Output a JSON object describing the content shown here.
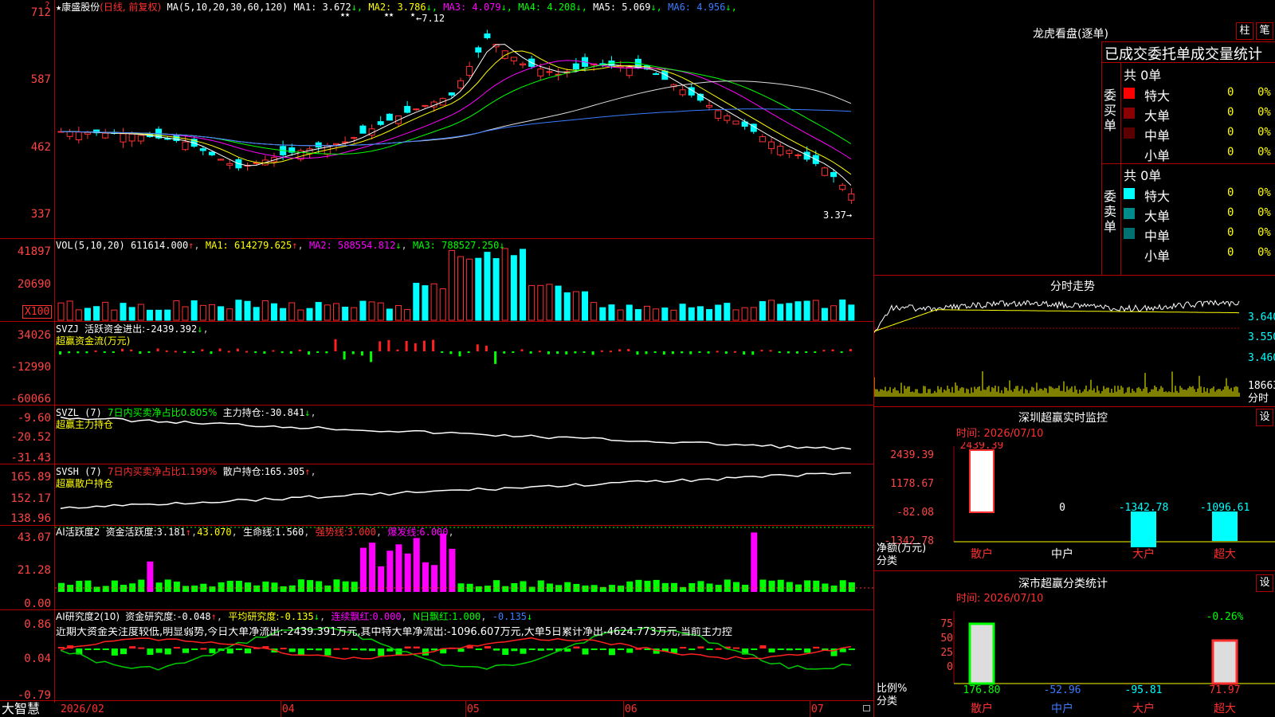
{
  "stock": {
    "name": "康盛股份",
    "star": "★",
    "mode": "(日线, 前复权)"
  },
  "header": {
    "ma_label": "MA(5,10,20,30,60,120)",
    "ma": [
      {
        "label": "MA1:",
        "value": "3.672",
        "arrow": "↓",
        "color": "#ffffff"
      },
      {
        "label": "MA2:",
        "value": "3.786",
        "arrow": "↓",
        "color": "#ffff00"
      },
      {
        "label": "MA3:",
        "value": "4.079",
        "arrow": "↓",
        "color": "#ff00ff"
      },
      {
        "label": "MA4:",
        "value": "4.208",
        "arrow": "↓",
        "color": "#00ff00"
      },
      {
        "label": "MA5:",
        "value": "5.069",
        "arrow": "↓",
        "color": "#ffffff"
      },
      {
        "label": "MA6:",
        "value": "4.956",
        "arrow": "↓",
        "color": "#3a7bff"
      }
    ]
  },
  "price_axis": [
    "712",
    "587",
    "462",
    "337"
  ],
  "price_notes": {
    "high": "7.12",
    "low": "3.37",
    "stars": [
      "★★",
      "★★",
      "★"
    ]
  },
  "vol": {
    "label": "VOL(5,10,20)",
    "value": "611614.000",
    "value_arrow": "↑",
    "ma1": "MA1: 614279.625",
    "ma1_arrow": "↑",
    "ma2": "MA2: 588554.812",
    "ma2_arrow": "↓",
    "ma3": "MA3: 788527.250",
    "ma3_arrow": "↓",
    "axis": [
      "41897",
      "20690"
    ],
    "unit": "X100"
  },
  "svzj": {
    "label": "SVZJ",
    "t1": "活跃资金进出:",
    "v1": "-2439.392",
    "v1_arrow": "↓",
    "sub": "超赢资金流(万元)",
    "axis": [
      "34026",
      "-12990",
      "-60066"
    ]
  },
  "svzl": {
    "label": "SVZL (7)",
    "t1": "7日内买卖净占比0.805%",
    "t2": "主力持仓:",
    "v2": "-30.841",
    "v2_arrow": "↓",
    "sub": "超赢主力持仓",
    "axis": [
      "-9.60",
      "-20.52",
      "-31.43"
    ]
  },
  "svsh": {
    "label": "SVSH (7)",
    "t1": "7日内买卖净占比1.199%",
    "t2": "散户持仓:",
    "v2": "165.305",
    "v2_arrow": "↑",
    "sub": "超赢散户持仓",
    "axis": [
      "165.89",
      "152.17",
      "138.96"
    ]
  },
  "ai_active": {
    "label": "AI活跃度2",
    "t1": "资金活跃度:",
    "v1": "3.181",
    "v1_arrow": "↑",
    "v2": "43.070",
    "t3": "生命线:",
    "v3": "1.560",
    "t4": "强势线:",
    "v4": "3.000",
    "t5": "爆发线:",
    "v5": "6.000",
    "axis": [
      "43.07",
      "21.28",
      "0.00"
    ]
  },
  "ai_research": {
    "label": "AI研究度2(10)",
    "t1": "资金研究度:",
    "v1": "-0.048",
    "v1_arrow": "↑",
    "t2": "平均研究度:",
    "v2": "-0.135",
    "v2_arrow": "↓",
    "t3": "连续飘红:",
    "v3": "0.000",
    "t4": "N日飘红:",
    "v4": "1.000",
    "v5": "-0.135",
    "v5_arrow": "↓",
    "sentence": "近期大资金关注度较低,明显弱势,今日大单净流出:-2439.391万元,其中特大单净流出:-1096.607万元,大单5日累计净出-4624.773万元,当前主力控",
    "axis": [
      "0.86",
      "0.04",
      "-0.79"
    ]
  },
  "date_axis": {
    "brand": "大智慧",
    "labels": [
      "2026/02",
      "04",
      "05",
      "06",
      "07"
    ]
  },
  "dragon": {
    "title": "龙虎看盘(逐单)",
    "btn1": "柱",
    "btn2": "笔",
    "subtitle": "已成交委托单成交量统计",
    "buy_label": "委买单",
    "sell_label": "委卖单",
    "buy_total": "共 0单",
    "sell_total": "共 0单",
    "buy_rows": [
      {
        "name": "特大",
        "count": "0",
        "pct": "0%",
        "color": "#ff0000"
      },
      {
        "name": "大单",
        "count": "0",
        "pct": "0%",
        "color": "#8b0000"
      },
      {
        "name": "中单",
        "count": "0",
        "pct": "0%",
        "color": "#5a0000"
      },
      {
        "name": "小单",
        "count": "0",
        "pct": "0%",
        "color": "#000000"
      }
    ],
    "sell_rows": [
      {
        "name": "特大",
        "count": "0",
        "pct": "0%",
        "color": "#00ffff"
      },
      {
        "name": "大单",
        "count": "0",
        "pct": "0%",
        "color": "#008b8b"
      },
      {
        "name": "中单",
        "count": "0",
        "pct": "0%",
        "color": "#007070"
      },
      {
        "name": "小单",
        "count": "0",
        "pct": "0%",
        "color": "#000000"
      }
    ]
  },
  "intraday": {
    "title": "分时走势",
    "axis": [
      "3.640",
      "3.550",
      "3.460"
    ],
    "vol_top": "18663",
    "vol_unit": "分时"
  },
  "sz_monitor": {
    "title": "深圳超赢实时监控",
    "btn": "设",
    "time": "时间: 2026/07/10",
    "axis": [
      "2439.39",
      "1178.67",
      "-82.08",
      "-1342.78"
    ],
    "unit1": "净额(万元)",
    "unit2": "分类",
    "cats": [
      "散户",
      "中户",
      "大户",
      "超大"
    ],
    "values": [
      "2439.39",
      "0",
      "-1342.78",
      "-1096.61"
    ]
  },
  "sz_class": {
    "title": "深市超赢分类统计",
    "btn": "设",
    "time": "时间: 2026/07/10",
    "axis": [
      "75",
      "50",
      "25",
      "0"
    ],
    "unit1": "比例%",
    "unit2": "分类",
    "cats": [
      "散户",
      "中户",
      "大户",
      "超大"
    ],
    "values": [
      "176.80",
      "-52.96",
      "-95.81",
      "71.97"
    ],
    "note": "-0.26%"
  }
}
